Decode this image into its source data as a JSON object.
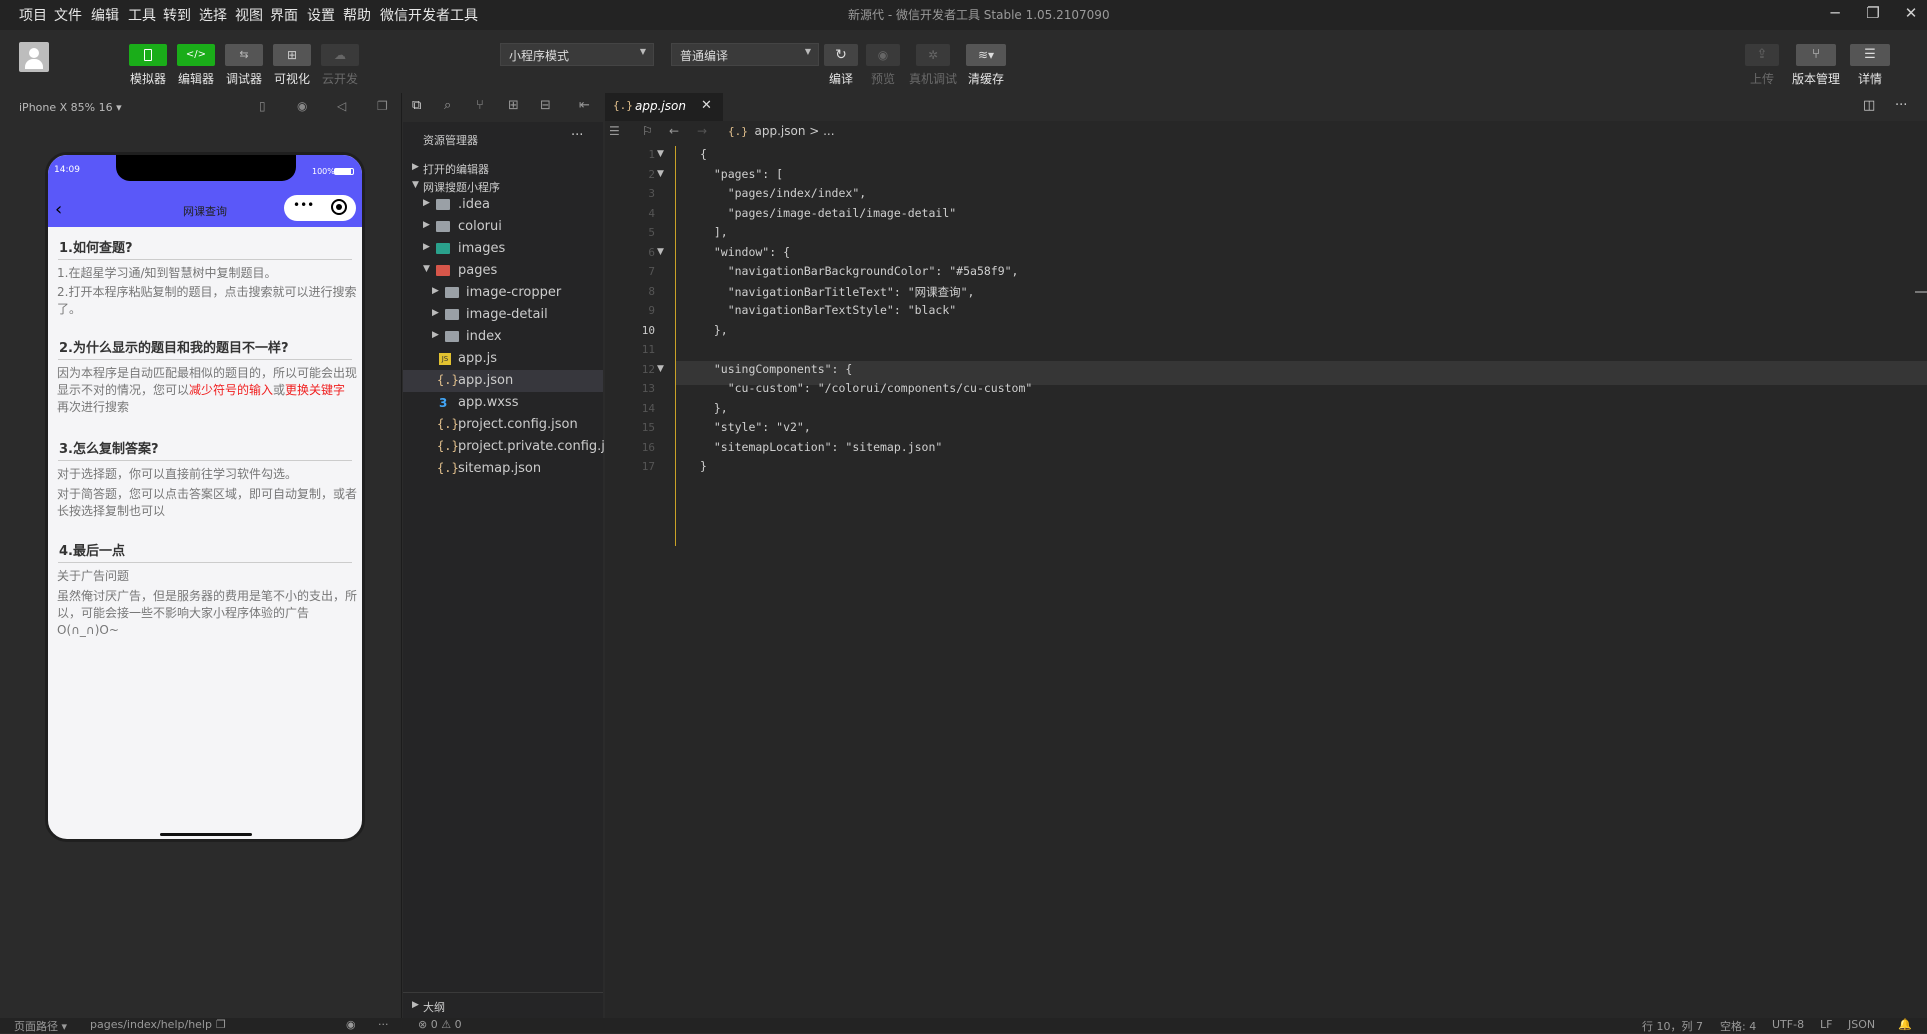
{
  "menubar": {
    "items": [
      "项目",
      "文件",
      "编辑",
      "工具",
      "转到",
      "选择",
      "视图",
      "界面",
      "设置",
      "帮助",
      "微信开发者工具"
    ],
    "window_title": "新源代 - 微信开发者工具 Stable 1.05.2107090"
  },
  "toolbar": {
    "mode_buttons": [
      "模拟器",
      "编辑器",
      "调试器",
      "可视化",
      "云开发"
    ],
    "mode_select": "小程序模式",
    "compile_select": "普通编译",
    "actions": [
      "编译",
      "预览",
      "真机调试",
      "清缓存"
    ],
    "right_actions": [
      "上传",
      "版本管理",
      "详情"
    ],
    "accent": "#1aad19"
  },
  "simulator": {
    "device": "iPhone X 85% 16 ▾",
    "status_time": "14:09",
    "battery": "100%",
    "nav_title": "网课查询",
    "nav_color": "#5a58f9",
    "sections": [
      {
        "heading": "1.如何查题?",
        "paras": [
          "1.在超星学习通/知到智慧树中复制题目。",
          "2.打开本程序粘贴复制的题目，点击搜索就可以进行搜索了。"
        ]
      },
      {
        "heading": "2.为什么显示的题目和我的题目不一样?",
        "p_before": "因为本程序是自动匹配最相似的题目的，所以可能会出现显示不对的情况，您可以",
        "red1": "减少符号的输入",
        "mid": "或",
        "red2": "更换关键字",
        "p_after": "再次进行搜索"
      },
      {
        "heading": "3.怎么复制答案?",
        "paras": [
          "对于选择题，你可以直接前往学习软件勾选。",
          "对于简答题，您可以点击答案区域，即可自动复制，或者长按选择复制也可以"
        ]
      },
      {
        "heading": "4.最后一点",
        "paras": [
          "关于广告问题",
          "虽然俺讨厌广告，但是服务器的费用是笔不小的支出，所以，可能会接一些不影响大家小程序体验的广告",
          "O(∩_∩)O~"
        ]
      }
    ]
  },
  "explorer": {
    "title": "资源管理器",
    "open_editors": "打开的编辑器",
    "project": "网课搜题小程序",
    "tree": [
      {
        "name": ".idea",
        "type": "folder",
        "depth": 1
      },
      {
        "name": "colorui",
        "type": "folder",
        "depth": 1
      },
      {
        "name": "images",
        "type": "folder",
        "depth": 1
      },
      {
        "name": "pages",
        "type": "folder-open",
        "depth": 1
      },
      {
        "name": "image-cropper",
        "type": "folder",
        "depth": 2
      },
      {
        "name": "image-detail",
        "type": "folder",
        "depth": 2
      },
      {
        "name": "index",
        "type": "folder",
        "depth": 2
      },
      {
        "name": "app.js",
        "type": "js",
        "depth": 1
      },
      {
        "name": "app.json",
        "type": "json",
        "depth": 1
      },
      {
        "name": "app.wxss",
        "type": "wxss",
        "depth": 1
      },
      {
        "name": "project.config.json",
        "type": "json",
        "depth": 1
      },
      {
        "name": "project.private.config.js...",
        "type": "json",
        "depth": 1
      },
      {
        "name": "sitemap.json",
        "type": "json",
        "depth": 1
      }
    ],
    "outline": "大纲"
  },
  "editor": {
    "tab": "app.json",
    "breadcrumb": "app.json > ...",
    "lines": [
      "{",
      "  \"pages\": [",
      "    \"pages/index/index\",",
      "    \"pages/image-detail/image-detail\"",
      "  ],",
      "  \"window\": {",
      "    \"navigationBarBackgroundColor\": \"#5a58f9\",",
      "    \"navigationBarTitleText\": \"网课查询\",",
      "    \"navigationBarTextStyle\": \"black\"",
      "  },",
      "",
      "  \"usingComponents\": {",
      "    \"cu-custom\": \"/colorui/components/cu-custom\"",
      "  },",
      "  \"style\": \"v2\",",
      "  \"sitemapLocation\": \"sitemap.json\"",
      "}"
    ]
  },
  "statusbar": {
    "left": "页面路径 ▾",
    "path": "pages/index/help/help",
    "errors": "⊗ 0 ⚠ 0",
    "position": "行 10，列 7",
    "spaces": "空格: 4",
    "encoding": "UTF-8",
    "eol": "LF",
    "lang": "JSON"
  }
}
